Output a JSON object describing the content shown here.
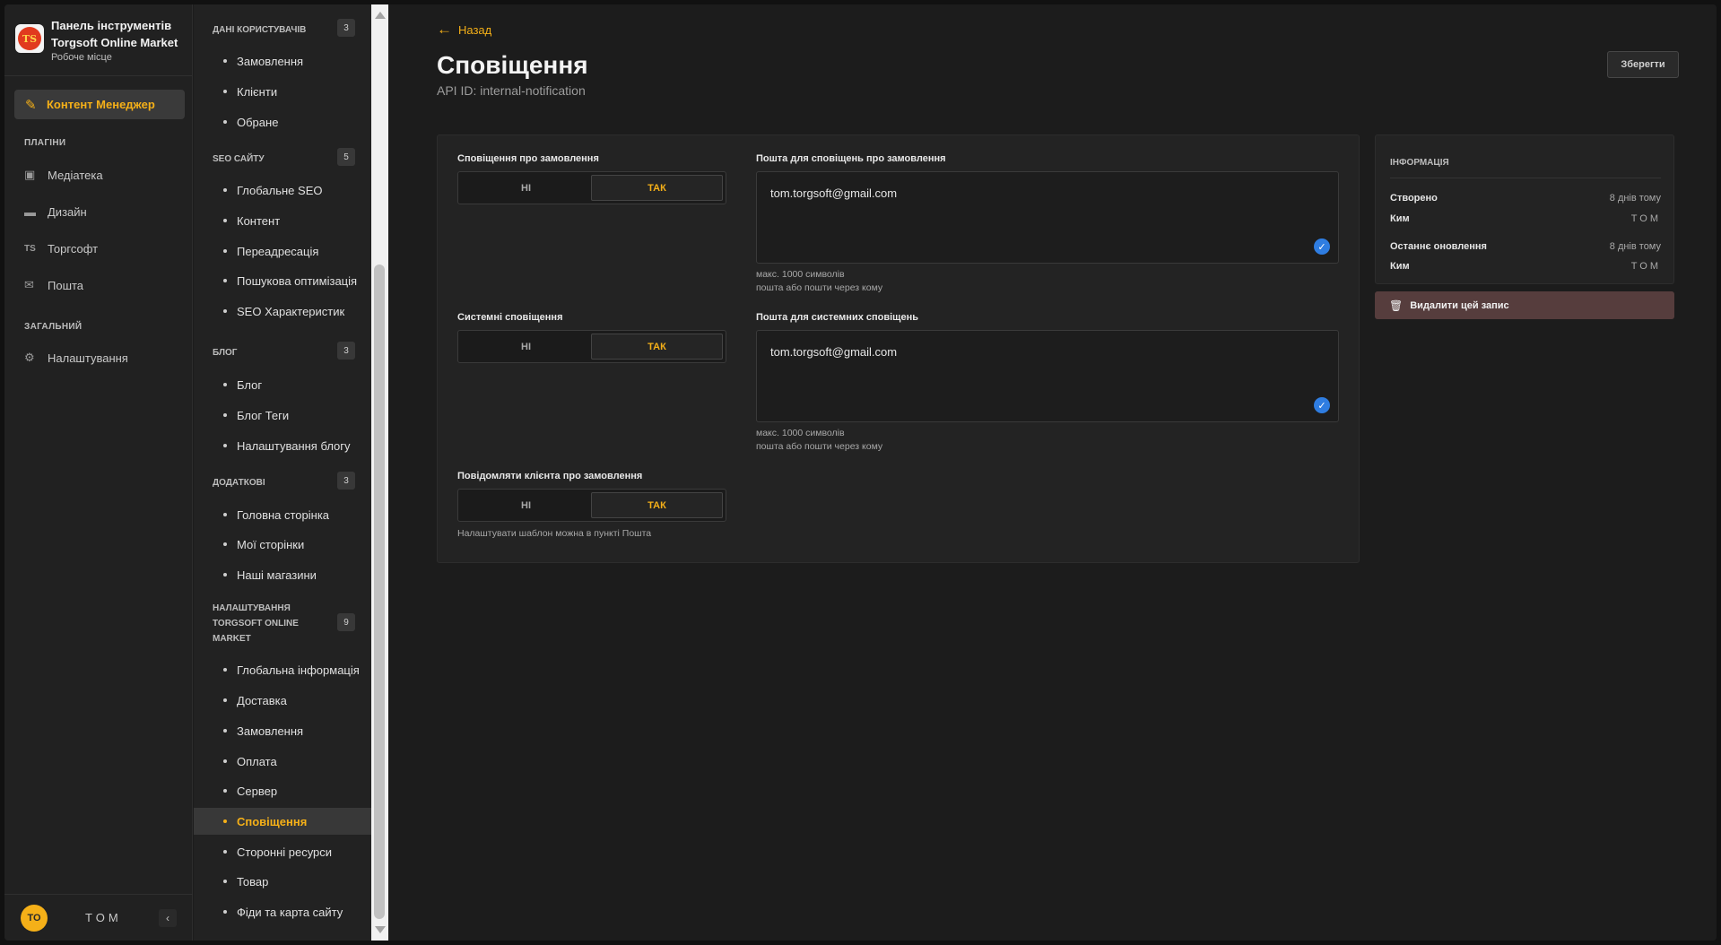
{
  "brand": {
    "title_line1": "Панель інструментів",
    "title_line2": "Torgsoft Online Market",
    "subtitle": "Робоче місце",
    "logo_text": "TS"
  },
  "nav": {
    "active": {
      "label": "Контент Менеджер",
      "icon": "edit-icon"
    },
    "sections": [
      {
        "title": "ПЛАГІНИ",
        "items": [
          {
            "label": "Медіатека",
            "icon": "image-icon"
          },
          {
            "label": "Дизайн",
            "icon": "paint-roller-icon"
          },
          {
            "label": "Торгсофт",
            "icon": "ts-icon"
          },
          {
            "label": "Пошта",
            "icon": "envelope-icon"
          }
        ]
      },
      {
        "title": "ЗАГАЛЬНИЙ",
        "items": [
          {
            "label": "Налаштування",
            "icon": "gear-icon"
          }
        ]
      }
    ]
  },
  "user": {
    "initials": "TO",
    "name": "TOM"
  },
  "content_types": {
    "groups": [
      {
        "title": "ДАНІ КОРИСТУВАЧІВ",
        "count": "3",
        "items": [
          "Замовлення",
          "Клієнти",
          "Обране"
        ]
      },
      {
        "title": "SEO САЙТУ",
        "count": "5",
        "items": [
          "Глобальне SEO",
          "Контент",
          "Переадресація",
          "Пошукова оптимізація",
          "SEO Характеристик"
        ]
      },
      {
        "title": "БЛОГ",
        "count": "3",
        "items": [
          "Блог",
          "Блог Теги",
          "Налаштування блогу"
        ]
      },
      {
        "title": "ДОДАТКОВІ",
        "count": "3",
        "items": [
          "Головна сторінка",
          "Мої сторінки",
          "Наші магазини"
        ]
      },
      {
        "title_lines": [
          "НАЛАШТУВАННЯ",
          "TORGSOFT ONLINE",
          "MARKET"
        ],
        "count": "9",
        "items": [
          "Глобальна інформація",
          "Доставка",
          "Замовлення",
          "Оплата",
          "Сервер",
          "Сповіщення",
          "Сторонні ресурси",
          "Товар",
          "Фіди та карта сайту"
        ]
      }
    ],
    "active_item": "Сповіщення"
  },
  "header": {
    "back_label": "Назад",
    "title": "Сповіщення",
    "api_id": "API ID: internal-notification",
    "save_label": "Зберегти"
  },
  "form": {
    "toggle_no": "НІ",
    "toggle_yes": "ТАК",
    "order_notify": {
      "label": "Сповіщення про замовлення",
      "value": "ТАК"
    },
    "system_notify": {
      "label": "Системні сповіщення",
      "value": "ТАК"
    },
    "client_notify": {
      "label": "Повідомляти клієнта про замовлення",
      "value": "ТАК",
      "hint": "Налаштувати шаблон можна в пункті Пошта"
    },
    "order_email": {
      "label": "Пошта для сповіщень про замовлення",
      "value": "tom.torgsoft@gmail.com",
      "hint1": "макс. 1000 символів",
      "hint2": "пошта або пошти через кому"
    },
    "system_email": {
      "label": "Пошта для системних сповіщень",
      "value": "tom.torgsoft@gmail.com",
      "hint1": "макс. 1000 символів",
      "hint2": "пошта або пошти через кому"
    }
  },
  "info": {
    "title": "ІНФОРМАЦІЯ",
    "created_label": "Створено",
    "created_value": "8 днів тому",
    "created_by_label": "Ким",
    "created_by_value": "TOM",
    "updated_label": "Останнє оновлення",
    "updated_value": "8 днів тому",
    "updated_by_label": "Ким",
    "updated_by_value": "TOM"
  },
  "delete_label": "Видалити цей запис",
  "colors": {
    "accent": "#f5b018",
    "check": "#2f7de1",
    "delete_bg": "#563d3d"
  }
}
